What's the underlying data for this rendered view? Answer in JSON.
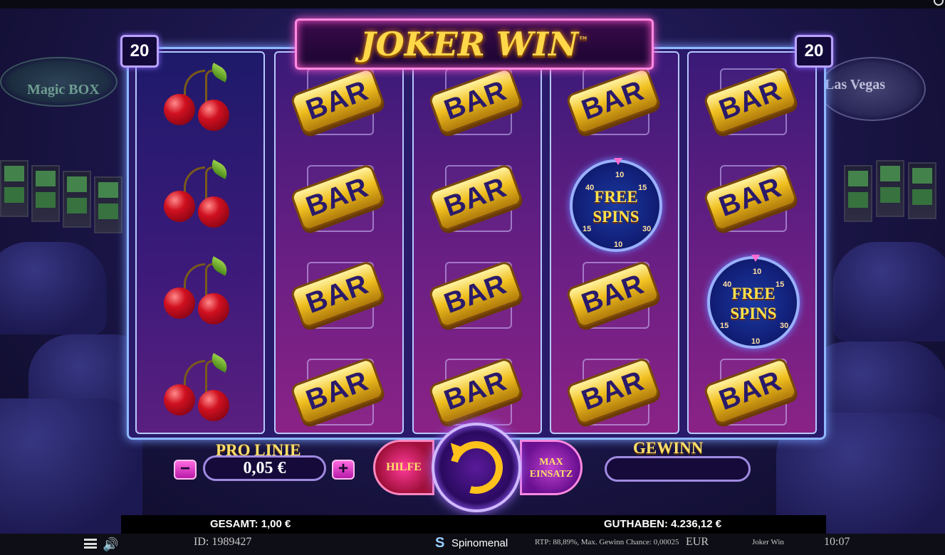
{
  "game": {
    "title": "JOKER WIN",
    "trademark": "™",
    "lines_left": "20",
    "lines_right": "20"
  },
  "background": {
    "sign_left": "Magic BOX",
    "sign_right": "Las Vegas"
  },
  "reels": [
    [
      "cherry",
      "cherry",
      "cherry",
      "cherry"
    ],
    [
      "bar",
      "bar",
      "bar",
      "bar"
    ],
    [
      "bar",
      "bar",
      "bar",
      "bar"
    ],
    [
      "bar",
      "free-spins",
      "bar",
      "bar"
    ],
    [
      "bar",
      "bar",
      "free-spins",
      "bar"
    ]
  ],
  "symbols": {
    "bar_label": "BAR",
    "free_spins_line1": "FREE",
    "free_spins_line2": "SPINS",
    "wheel_numbers": [
      "10",
      "15",
      "30",
      "10",
      "15",
      "40"
    ]
  },
  "controls": {
    "pro_linie_label": "PRO LINIE",
    "bet_per_line": "0,05 €",
    "minus": "−",
    "plus": "+",
    "hilfe": "HILFE",
    "max_einsatz_line1": "MAX",
    "max_einsatz_line2": "EINSATZ",
    "gewinn_label": "GEWINN",
    "gewinn_value": ""
  },
  "status": {
    "gesamt": "GESAMT: 1,00 €",
    "guthaben": "GUTHABEN: 4.236,12 €"
  },
  "footer": {
    "id": "ID: 1989427",
    "provider": "Spinomenal",
    "rtp": "RTP: 88,89%, Max. Gewinn Chance: 0,00025",
    "currency": "EUR",
    "game_name": "Joker Win",
    "time": "10:07"
  }
}
